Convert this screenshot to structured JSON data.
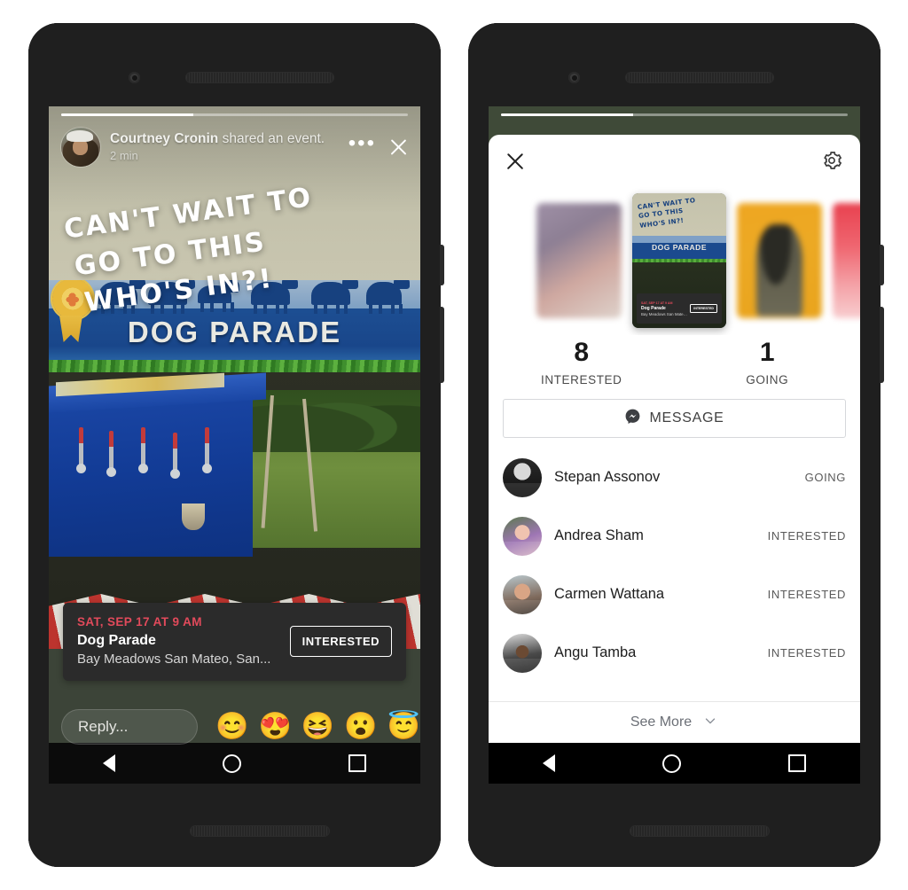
{
  "left_phone": {
    "story": {
      "progress_percent": 38,
      "author_name": "Courtney Cronin",
      "author_action": " shared an event.",
      "timestamp": "2 min",
      "more_icon": "•••",
      "caption_lines": [
        "CAN'T WAIT TO",
        "GO TO THIS",
        "WHO'S IN?!"
      ],
      "photo_banner_text": "DOG PARADE",
      "event_card": {
        "date": "SAT,  SEP 17 AT 9 AM",
        "title": "Dog Parade",
        "location": "Bay Meadows San Mateo, San...",
        "button_label": "INTERESTED"
      },
      "reply": {
        "placeholder": "Reply...",
        "emojis": [
          "😊",
          "😍",
          "😆",
          "😮",
          "😇"
        ]
      }
    },
    "navbar": {
      "back": "back-triangle",
      "home": "home-circle",
      "recents": "recents-square"
    }
  },
  "right_phone": {
    "progress_percent": 38,
    "sheet": {
      "close_icon": "close-icon",
      "settings_icon": "gear-icon",
      "thumbnails": [
        {
          "id": "thumb-1",
          "active": false
        },
        {
          "id": "thumb-2",
          "active": true
        },
        {
          "id": "thumb-3",
          "active": false
        },
        {
          "id": "thumb-4",
          "active": false
        }
      ],
      "active_thumb": {
        "caption_lines": [
          "CAN'T WAIT TO",
          "GO TO THIS",
          "WHO'S IN?!"
        ],
        "banner_text": "DOG PARADE",
        "event_date": "SAT, SEP 17 AT 9 AM",
        "event_title": "Dog Parade",
        "event_location": "Bay Meadows San Mateo, San...",
        "event_button": "INTERESTED"
      },
      "stats": [
        {
          "value": "8",
          "label": "INTERESTED"
        },
        {
          "value": "1",
          "label": "GOING"
        }
      ],
      "message_button": {
        "label": "MESSAGE",
        "icon": "messenger-icon"
      },
      "people": [
        {
          "name": "Stepan Assonov",
          "status": "GOING"
        },
        {
          "name": "Andrea Sham",
          "status": "INTERESTED"
        },
        {
          "name": "Carmen Wattana",
          "status": "INTERESTED"
        },
        {
          "name": "Angu Tamba",
          "status": "INTERESTED"
        }
      ],
      "see_more": {
        "label": "See More",
        "icon": "chevron-down-icon"
      }
    },
    "navbar": {
      "back": "back-triangle",
      "home": "home-circle",
      "recents": "recents-square"
    }
  },
  "colors": {
    "accent_red": "#e24a5b",
    "sheet_bg": "#ffffff",
    "story_bg": "#3c4438",
    "phone_body": "#1f1f1f"
  }
}
